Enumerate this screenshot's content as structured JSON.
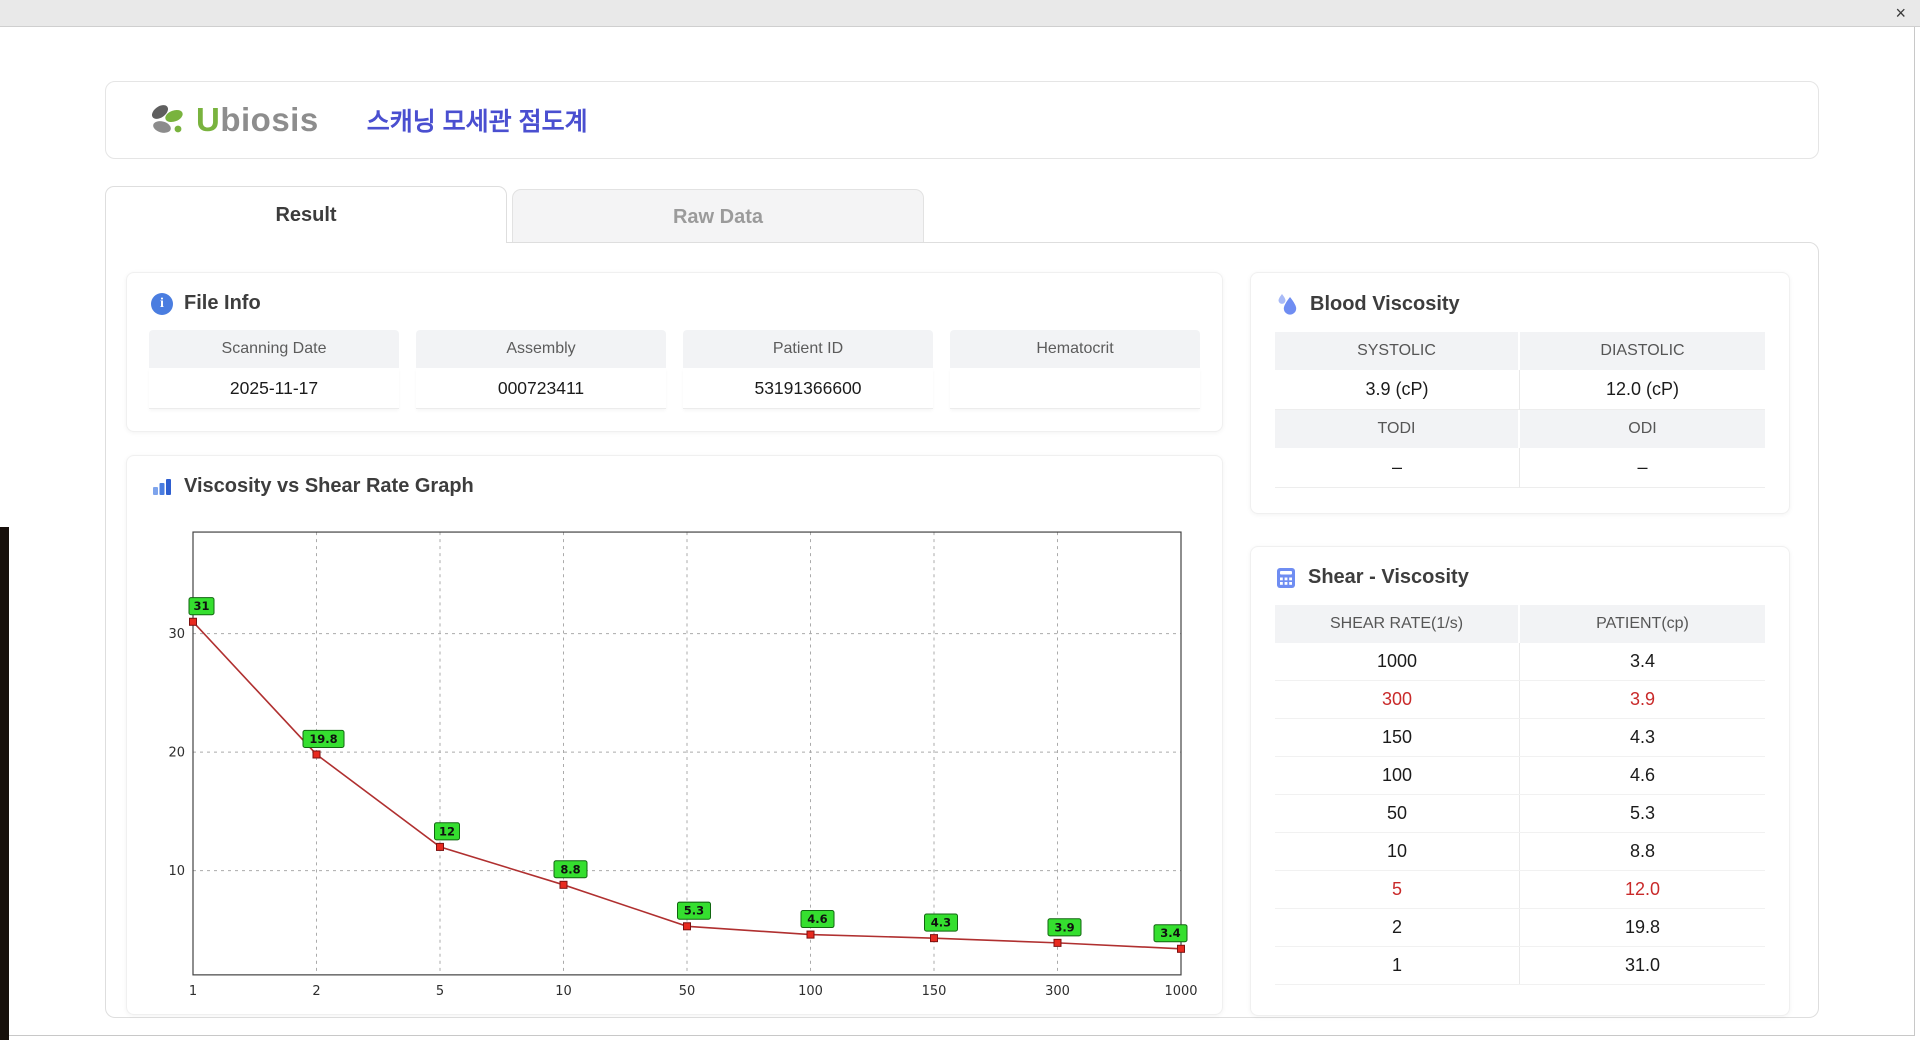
{
  "window": {
    "close_glyph": "×"
  },
  "header": {
    "logo": {
      "accent": "U",
      "rest": "biosis"
    },
    "title": "스캐닝 모세관 점도계"
  },
  "tabs": [
    {
      "label": "Result",
      "active": true
    },
    {
      "label": "Raw Data",
      "active": false
    }
  ],
  "file_info": {
    "title": "File Info",
    "info_glyph": "i",
    "fields": [
      {
        "label": "Scanning Date",
        "value": "2025-11-17"
      },
      {
        "label": "Assembly",
        "value": "000723411"
      },
      {
        "label": "Patient ID",
        "value": "53191366600"
      },
      {
        "label": "Hematocrit",
        "value": ""
      }
    ]
  },
  "blood_viscosity": {
    "title": "Blood Viscosity",
    "sections": [
      {
        "headers": [
          "SYSTOLIC",
          "DIASTOLIC"
        ],
        "values": [
          "3.9 (cP)",
          "12.0 (cP)"
        ]
      },
      {
        "headers": [
          "TODI",
          "ODI"
        ],
        "values": [
          "–",
          "–"
        ]
      }
    ]
  },
  "shear_viscosity": {
    "title": "Shear - Viscosity",
    "columns": [
      "SHEAR RATE(1/s)",
      "PATIENT(cp)"
    ],
    "rows": [
      {
        "shear_rate": "1000",
        "patient": "3.4",
        "highlight": false
      },
      {
        "shear_rate": "300",
        "patient": "3.9",
        "highlight": true
      },
      {
        "shear_rate": "150",
        "patient": "4.3",
        "highlight": false
      },
      {
        "shear_rate": "100",
        "patient": "4.6",
        "highlight": false
      },
      {
        "shear_rate": "50",
        "patient": "5.3",
        "highlight": false
      },
      {
        "shear_rate": "10",
        "patient": "8.8",
        "highlight": false
      },
      {
        "shear_rate": "5",
        "patient": "12.0",
        "highlight": true
      },
      {
        "shear_rate": "2",
        "patient": "19.8",
        "highlight": false
      },
      {
        "shear_rate": "1",
        "patient": "31.0",
        "highlight": false
      }
    ]
  },
  "chart_data": {
    "type": "line",
    "title": "Viscosity vs Shear Rate Graph",
    "categories": [
      "1",
      "2",
      "5",
      "10",
      "50",
      "100",
      "150",
      "300",
      "1000"
    ],
    "values": [
      31,
      19.8,
      12,
      8.8,
      5.3,
      4.6,
      4.3,
      3.9,
      3.4
    ],
    "point_labels": [
      "31",
      "19.8",
      "12",
      "8.8",
      "5.3",
      "4.6",
      "4.3",
      "3.9",
      "3.4"
    ],
    "yticks": [
      10,
      20,
      30
    ],
    "ylim": [
      1.2,
      38.6
    ],
    "xlabel": "",
    "ylabel": "",
    "grid": true,
    "legend": false,
    "line_color": "#b03030",
    "point_color": "#e82a1f",
    "point_border": "#7c1010",
    "label_bg": "#35df2f",
    "label_border": "#116611"
  },
  "colors": {
    "accent_blue": "#4a4fd0",
    "icon_blue": "#4a7de0",
    "highlight_red": "#c92a2a",
    "band_gray": "#f2f3f5",
    "logo_green": "#79b33e",
    "logo_gray": "#8d8d8d"
  }
}
